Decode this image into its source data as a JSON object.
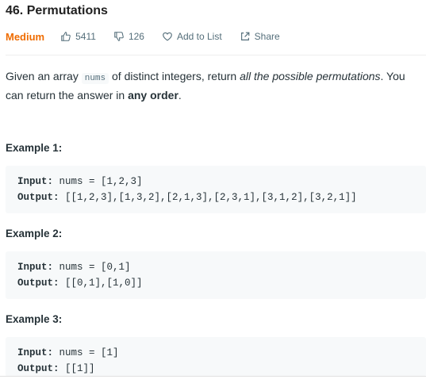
{
  "problem": {
    "title": "46. Permutations",
    "difficulty": "Medium",
    "likes": "5411",
    "dislikes": "126",
    "add_to_list": "Add to List",
    "share": "Share"
  },
  "description": {
    "part1": "Given an array ",
    "code": "nums",
    "part2": " of distinct integers, return ",
    "italic": "all the possible permutations",
    "part3": ". You can return the answer in ",
    "bold": "any order",
    "part4": "."
  },
  "examples": [
    {
      "title": "Example 1:",
      "input_label": "Input:",
      "input_value": " nums = [1,2,3]",
      "output_label": "Output:",
      "output_value": " [[1,2,3],[1,3,2],[2,1,3],[2,3,1],[3,1,2],[3,2,1]]"
    },
    {
      "title": "Example 2:",
      "input_label": "Input:",
      "input_value": " nums = [0,1]",
      "output_label": "Output:",
      "output_value": " [[0,1],[1,0]]"
    },
    {
      "title": "Example 3:",
      "input_label": "Input:",
      "input_value": " nums = [1]",
      "output_label": "Output:",
      "output_value": " [[1]]"
    }
  ]
}
